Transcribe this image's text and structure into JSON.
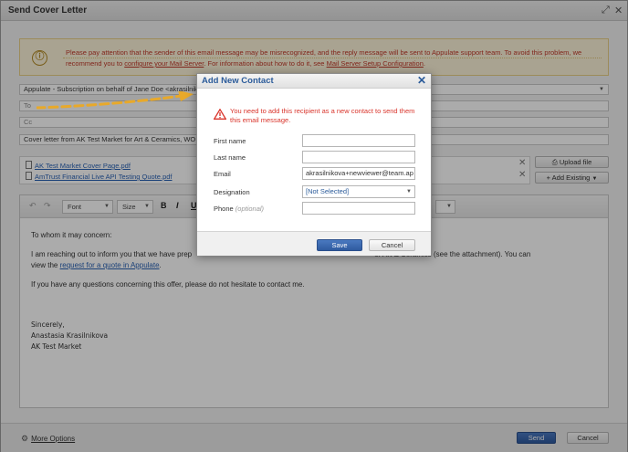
{
  "window": {
    "title": "Send Cover Letter",
    "expand_glyph": "⤢",
    "close_glyph": "✕"
  },
  "warning": {
    "icon": "ⓘ",
    "line1": "Please pay attention that the sender of this email message may be misrecognized, and the reply message will be sent to Appulate support team. To avoid this problem, we",
    "line2_pre": "recommend you to ",
    "link1": "configure your Mail Server",
    "line2_mid": ". For information about how to do it, see ",
    "link2": "Mail Server Setup Configuration",
    "line2_post": "."
  },
  "from": {
    "value": "Appulate - Subscription on behalf of Jane Doe <akrasilnik"
  },
  "to": {
    "label": "To"
  },
  "cc": {
    "label": "Cc"
  },
  "subject": {
    "value": "Cover letter from AK Test Market for Art & Ceramics, WO"
  },
  "attachments": [
    {
      "name": "AK Test Market Cover Page.pdf"
    },
    {
      "name": "AmTrust Financial Live API Testing Quote.pdf"
    }
  ],
  "upload_label": "Upload file",
  "add_existing_label": "Add Existing",
  "toolbar": {
    "font_label": "Font",
    "size_label": "Size",
    "bold": "B",
    "italic": "I",
    "underline": "U",
    "undo": "↶",
    "redo": "↷"
  },
  "editor": {
    "greeting": "To whom it may concern:",
    "para1_pre": "I am reaching out to inform you that we have prep",
    "para1_post": "or Art & Ceramics (see the attachment). You can",
    "para1_line2_pre": "view the ",
    "para1_link": "request for a quote in Appulate",
    "para1_line2_post": ".",
    "para2": "If you have any questions concerning this offer, please do not hesitate to contact me.",
    "sig1": "Sincerely,",
    "sig2": "Anastasia Krasilnikova",
    "sig3": "AK Test Market"
  },
  "footer": {
    "more_options": "More Options",
    "send": "Send",
    "cancel": "Cancel"
  },
  "modal": {
    "title": "Add New Contact",
    "close": "✕",
    "error": "You need to add this recipient as a new contact to send them this email message.",
    "first_name_label": "First name",
    "last_name_label": "Last name",
    "email_label": "Email",
    "email_value": "akrasilnikova+newviewer@team.ap",
    "designation_label": "Designation",
    "designation_value": "[Not Selected]",
    "phone_label": "Phone",
    "phone_hint": "(optional)",
    "save": "Save",
    "cancel": "Cancel"
  },
  "colors": {
    "accent": "#2b5b9a",
    "error": "#d9342b",
    "warning_bg": "#fdf4d8",
    "arrow": "#e8a92a"
  }
}
